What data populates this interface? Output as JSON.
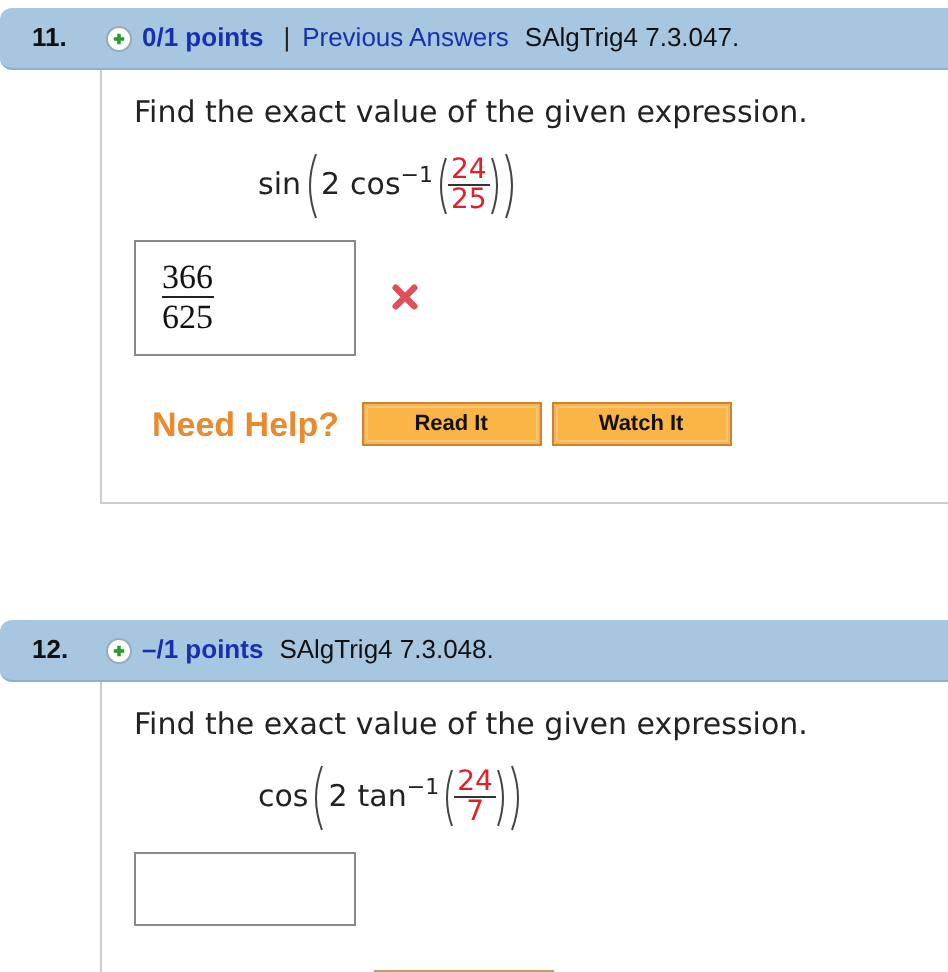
{
  "questions": [
    {
      "number": "11.",
      "points": "0/1 points",
      "previous_answers": "Previous Answers",
      "separator": "|",
      "source": "SAlgTrig4 7.3.047.",
      "prompt": "Find the exact value of the given expression.",
      "expression": {
        "outer": "sin",
        "coefficient": "2",
        "inner": "cos",
        "exponent": "−1",
        "numerator": "24",
        "denominator": "25"
      },
      "answer": {
        "numerator": "366",
        "denominator": "625"
      },
      "correct": false,
      "help": {
        "label": "Need Help?",
        "buttons": [
          "Read It",
          "Watch It"
        ]
      }
    },
    {
      "number": "12.",
      "points": "–/1 points",
      "source": "SAlgTrig4 7.3.048.",
      "prompt": "Find the exact value of the given expression.",
      "expression": {
        "outer": "cos",
        "coefficient": "2",
        "inner": "tan",
        "exponent": "−1",
        "numerator": "24",
        "denominator": "7"
      },
      "help_cut": true
    }
  ]
}
